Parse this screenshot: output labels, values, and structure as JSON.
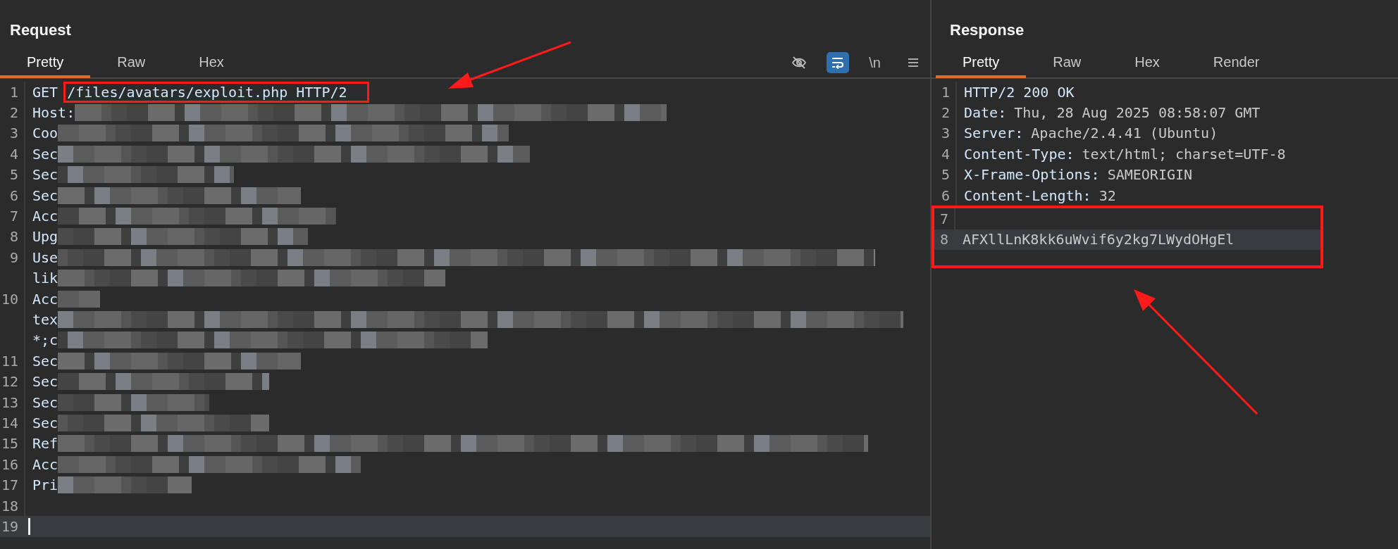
{
  "request": {
    "title": "Request",
    "tabs": [
      {
        "label": "Pretty",
        "selected": true
      },
      {
        "label": "Raw",
        "selected": false
      },
      {
        "label": "Hex",
        "selected": false
      }
    ],
    "toolbar": [
      {
        "kind": "hide"
      },
      {
        "kind": "wrap",
        "selected": true
      },
      {
        "kind": "text",
        "label": "\\n"
      },
      {
        "kind": "menu"
      }
    ],
    "lines": [
      {
        "number": "1",
        "parts": [
          {
            "text": "GET ",
            "highlighted": false
          },
          {
            "text": "/files/avatars/exploit.php HTTP/2",
            "highlighted": true
          }
        ],
        "redacted": false,
        "current": false
      },
      {
        "number": "2",
        "parts": [
          {
            "text": "Host:",
            "highlighted": false
          }
        ],
        "redacted": true,
        "current": false
      },
      {
        "number": "3",
        "parts": [
          {
            "text": "Coo",
            "highlighted": false
          }
        ],
        "redacted": true,
        "current": false
      },
      {
        "number": "4",
        "parts": [
          {
            "text": "Sec",
            "highlighted": false
          }
        ],
        "redacted": true,
        "current": false
      },
      {
        "number": "5",
        "parts": [
          {
            "text": "Sec",
            "highlighted": false
          }
        ],
        "redacted": true,
        "current": false
      },
      {
        "number": "6",
        "parts": [
          {
            "text": "Sec",
            "highlighted": false
          }
        ],
        "redacted": true,
        "current": false
      },
      {
        "number": "7",
        "parts": [
          {
            "text": "Acc",
            "highlighted": false
          }
        ],
        "redacted": true,
        "current": false
      },
      {
        "number": "8",
        "parts": [
          {
            "text": "Upg",
            "highlighted": false
          }
        ],
        "redacted": true,
        "current": false
      },
      {
        "number": "9",
        "parts": [
          {
            "text": "Use",
            "highlighted": false
          }
        ],
        "redacted": true,
        "current": false
      },
      {
        "parts": [
          {
            "text": "lik",
            "highlighted": false
          }
        ],
        "redacted": true,
        "current": false
      },
      {
        "number": "10",
        "parts": [
          {
            "text": "Acc",
            "highlighted": false
          }
        ],
        "redacted": true,
        "current": false
      },
      {
        "parts": [
          {
            "text": "tex",
            "highlighted": false
          }
        ],
        "redacted": true,
        "current": false
      },
      {
        "parts": [
          {
            "text": "*;c",
            "highlighted": false
          }
        ],
        "redacted": true,
        "current": false
      },
      {
        "number": "11",
        "parts": [
          {
            "text": "Sec",
            "highlighted": false
          }
        ],
        "redacted": true,
        "current": false
      },
      {
        "number": "12",
        "parts": [
          {
            "text": "Sec",
            "highlighted": false
          }
        ],
        "redacted": true,
        "current": false
      },
      {
        "number": "13",
        "parts": [
          {
            "text": "Sec",
            "highlighted": false
          }
        ],
        "redacted": true,
        "current": false
      },
      {
        "number": "14",
        "parts": [
          {
            "text": "Sec",
            "highlighted": false
          }
        ],
        "redacted": true,
        "current": false
      },
      {
        "number": "15",
        "parts": [
          {
            "text": "Ref",
            "highlighted": false
          }
        ],
        "redacted": true,
        "current": false
      },
      {
        "number": "16",
        "parts": [
          {
            "text": "Acc",
            "highlighted": false
          }
        ],
        "redacted": true,
        "current": false
      },
      {
        "number": "17",
        "parts": [
          {
            "text": "Pri",
            "highlighted": false
          }
        ],
        "redacted": true,
        "current": false
      },
      {
        "number": "18",
        "redacted": false,
        "current": false
      },
      {
        "number": "19",
        "redacted": false,
        "current": true
      }
    ]
  },
  "response": {
    "title": "Response",
    "tabs": [
      {
        "label": "Pretty",
        "selected": true
      },
      {
        "label": "Raw",
        "selected": false
      },
      {
        "label": "Hex",
        "selected": false
      },
      {
        "label": "Render",
        "selected": false
      }
    ],
    "lines": [
      {
        "number": "1",
        "key": "HTTP/2 200 OK",
        "highlighted": false,
        "current": false
      },
      {
        "number": "2",
        "key": "Date:",
        "value": "Thu, 28 Aug 2025 08:58:07 GMT",
        "highlighted": false,
        "current": false
      },
      {
        "number": "3",
        "key": "Server:",
        "value": "Apache/2.4.41 (Ubuntu)",
        "highlighted": false,
        "current": false
      },
      {
        "number": "4",
        "key": "Content-Type:",
        "value": "text/html; charset=UTF-8",
        "highlighted": false,
        "current": false
      },
      {
        "number": "5",
        "key": "X-Frame-Options:",
        "value": "SAMEORIGIN",
        "highlighted": false,
        "current": false
      },
      {
        "number": "6",
        "key": "Content-Length:",
        "value": "32",
        "highlighted": false,
        "current": false
      },
      {
        "number": "7",
        "highlighted": true,
        "current": false
      },
      {
        "number": "8",
        "value": "AFXllLnK8kk6uWvif6y2kg7LWydOHgEl",
        "highlighted": true,
        "current": true
      }
    ]
  }
}
